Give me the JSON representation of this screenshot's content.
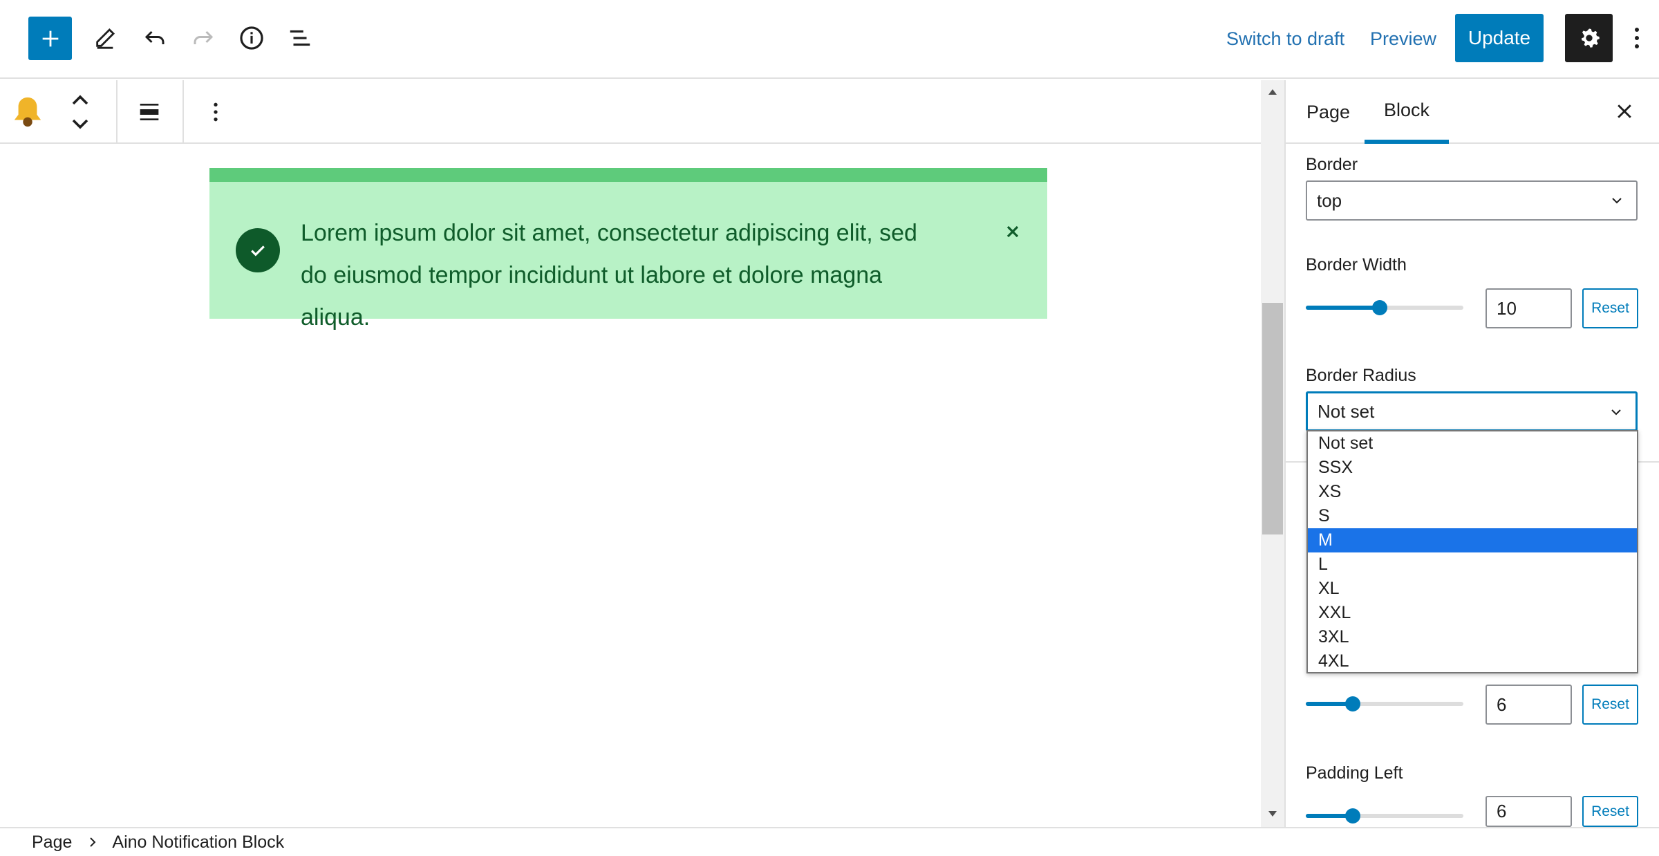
{
  "toolbar": {
    "switch_to_draft": "Switch to draft",
    "preview": "Preview",
    "update": "Update"
  },
  "notice": {
    "text": "Lorem ipsum dolor sit amet, consectetur adipiscing elit, sed do eiusmod tempor incididunt ut labore et dolore magna aliqua."
  },
  "sidebar": {
    "tabs": [
      "Page",
      "Block"
    ],
    "active_tab": "Block",
    "border": {
      "label": "Border",
      "value": "top"
    },
    "border_width": {
      "label": "Border Width",
      "value": "10",
      "reset": "Reset",
      "level": 0.47
    },
    "border_radius": {
      "label": "Border Radius",
      "value": "Not set"
    },
    "hidden_setting": {
      "value": "6",
      "reset": "Reset",
      "level": 0.3
    },
    "padding_left": {
      "label": "Padding Left",
      "value": "6",
      "reset": "Reset",
      "level": 0.3
    }
  },
  "dropdown": {
    "options": [
      "Not set",
      "SSX",
      "XS",
      "S",
      "M",
      "L",
      "XL",
      "XXL",
      "3XL",
      "4XL"
    ],
    "highlighted": "M"
  },
  "breadcrumb": [
    "Page",
    "Aino Notification Block"
  ],
  "colors": {
    "accent": "#007cba",
    "notice_bg": "#b8f2c6",
    "notice_border": "#5ecb7b",
    "notice_text": "#0f5c2a",
    "bell": "#f0b429"
  }
}
